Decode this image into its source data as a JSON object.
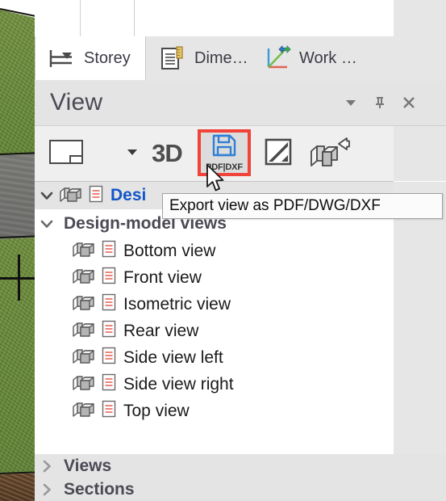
{
  "window": {
    "panel_title": "View"
  },
  "viewport": {
    "name": "3d-viewport",
    "materials": [
      "grass",
      "road",
      "dirt"
    ],
    "crosshair": "origin-crosshair"
  },
  "tabs": [
    {
      "id": "storey",
      "label": "Storey",
      "icon": "storey-level-icon",
      "active": true
    },
    {
      "id": "dimension",
      "label": "Dime…",
      "icon": "dimension-doc-icon",
      "active": false
    },
    {
      "id": "workplane",
      "label": "Work …",
      "icon": "workplane-axes-icon",
      "active": false
    }
  ],
  "panel_header": {
    "title": "View",
    "buttons": [
      {
        "id": "menu",
        "icon": "chevron-down-icon",
        "title": "Panel menu"
      },
      {
        "id": "pin",
        "icon": "pin-icon",
        "title": "Pin panel"
      },
      {
        "id": "close",
        "icon": "close-icon",
        "title": "Close panel"
      }
    ]
  },
  "toolbar": {
    "buttons": [
      {
        "id": "new-view",
        "icon": "new-view-icon",
        "label": "",
        "highlighted": false
      },
      {
        "id": "view-dropdown",
        "icon": "caret-down-icon",
        "label": "",
        "highlighted": false
      },
      {
        "id": "3d-view",
        "icon": "3d-text-icon",
        "label": "3D",
        "highlighted": false
      },
      {
        "id": "export-pdf",
        "icon": "save-floppy-icon",
        "label": "PDF|DXF",
        "highlighted": true
      },
      {
        "id": "export-image",
        "icon": "image-render-icon",
        "label": "",
        "highlighted": false
      },
      {
        "id": "export-model",
        "icon": "model-export-icon",
        "label": "",
        "highlighted": false
      }
    ],
    "highlight_color": "#f0433a"
  },
  "tooltip": {
    "text": "Export view as PDF/DWG/DXF",
    "visible": true
  },
  "tree": {
    "root": {
      "label": "Desi",
      "chevron": "chevron-down-icon",
      "icons": [
        "model-box-icon",
        "document-lines-icon"
      ],
      "selected": true,
      "expanded": true,
      "text_color": "#1356c8"
    },
    "group": {
      "label": "Design-model views",
      "chevron": "chevron-down-icon",
      "expanded": true
    },
    "items": [
      {
        "label": "Bottom view",
        "icons": [
          "model-box-icon",
          "document-lines-icon"
        ]
      },
      {
        "label": "Front view",
        "icons": [
          "model-box-icon",
          "document-lines-icon"
        ]
      },
      {
        "label": "Isometric view",
        "icons": [
          "model-box-icon",
          "document-lines-icon"
        ]
      },
      {
        "label": "Rear view",
        "icons": [
          "model-box-icon",
          "document-lines-icon"
        ]
      },
      {
        "label": "Side view left",
        "icons": [
          "model-box-icon",
          "document-lines-icon"
        ]
      },
      {
        "label": "Side view right",
        "icons": [
          "model-box-icon",
          "document-lines-icon"
        ]
      },
      {
        "label": "Top view",
        "icons": [
          "model-box-icon",
          "document-lines-icon"
        ]
      }
    ],
    "collapsed_groups": [
      {
        "label": "Views",
        "chevron": "chevron-right-icon",
        "expanded": false
      },
      {
        "label": "Sections",
        "chevron": "chevron-right-icon",
        "expanded": false
      }
    ]
  },
  "cursor": {
    "type": "arrow-pointer"
  }
}
